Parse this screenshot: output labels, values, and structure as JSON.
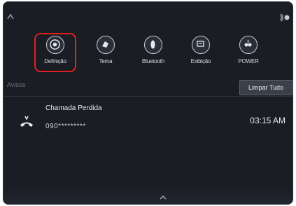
{
  "quick_settings": [
    {
      "label": "Definição",
      "icon": "settings-dial-icon",
      "selected": true
    },
    {
      "label": "Tema",
      "icon": "theme-icon",
      "selected": false
    },
    {
      "label": "Bluetooth",
      "icon": "bluetooth-icon",
      "selected": false
    },
    {
      "label": "Exibição",
      "icon": "display-icon",
      "selected": false
    },
    {
      "label": "POWER",
      "icon": "power-audio-icon",
      "selected": false
    }
  ],
  "notifications": {
    "section_title": "Avisos",
    "clear_all_label": "Limpar Tudo",
    "items": [
      {
        "title": "Chamada Perdida",
        "number": "090*********",
        "time": "03:15 AM",
        "icon": "missed-call-icon"
      }
    ]
  },
  "colors": {
    "background": "#1a1d24",
    "highlight": "#e02020",
    "text": "#e6e9ee"
  }
}
